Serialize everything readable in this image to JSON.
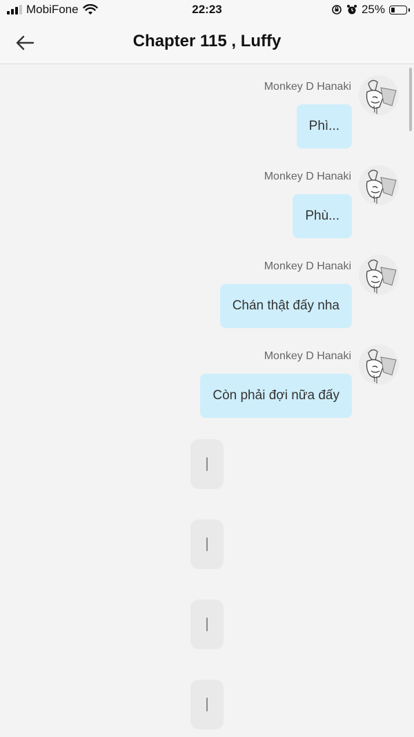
{
  "status_bar": {
    "carrier": "MobiFone",
    "time": "22:23",
    "battery_percent": "25%",
    "battery_level": 0.25,
    "icons": [
      "signal-icon",
      "wifi-icon",
      "rotation-lock-icon",
      "alarm-icon",
      "battery-icon"
    ]
  },
  "header": {
    "title": "Chapter 115 , Luffy",
    "back_icon": "arrow-left-icon"
  },
  "messages": [
    {
      "sender": "Monkey D Hanaki",
      "text": "Phì..."
    },
    {
      "sender": "Monkey D Hanaki",
      "text": "Phù..."
    },
    {
      "sender": "Monkey D Hanaki",
      "text": "Chán thật đấy nha"
    },
    {
      "sender": "Monkey D Hanaki",
      "text": "Còn phải đợi nữa đấy"
    }
  ],
  "typing_indicators": 4,
  "colors": {
    "bubble": "#cfeefb",
    "background": "#f3f3f3",
    "placeholder_bubble": "#e9e9e9"
  }
}
